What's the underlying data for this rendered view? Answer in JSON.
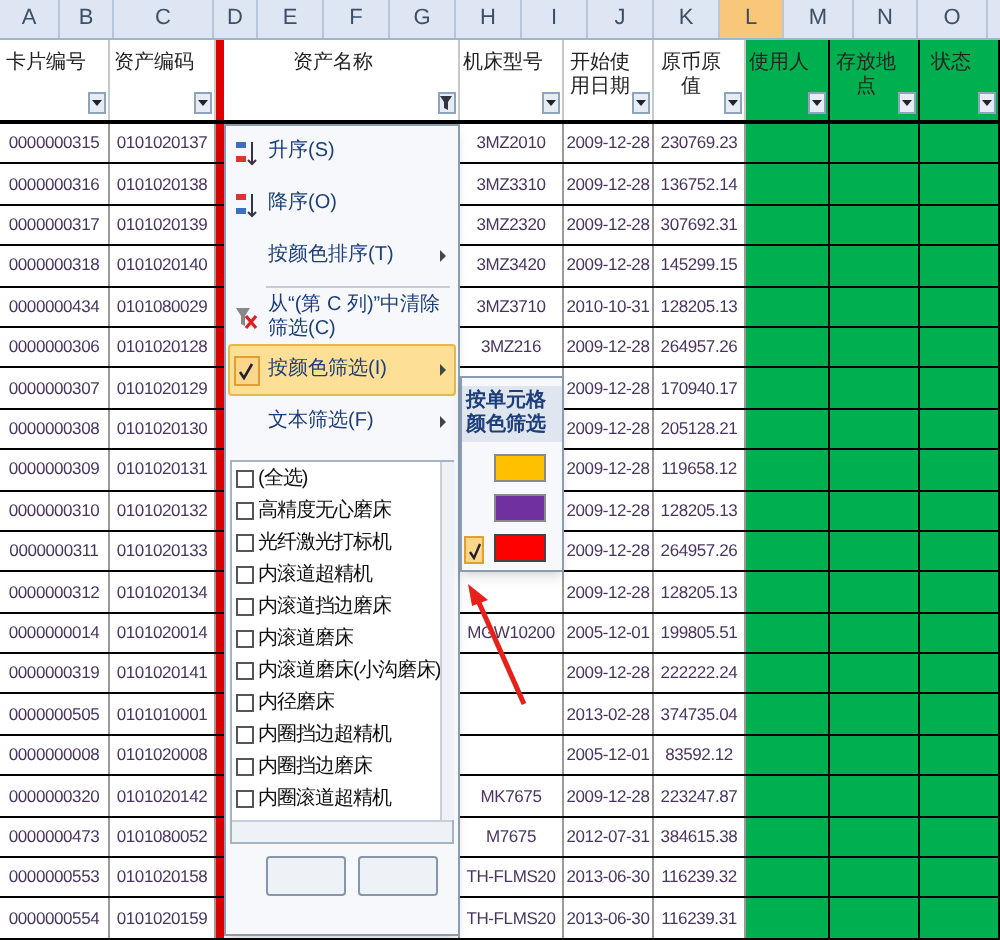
{
  "column_letters": [
    {
      "label": "A",
      "selected": false
    },
    {
      "label": "B",
      "selected": false
    },
    {
      "label": "C",
      "selected": false
    },
    {
      "label": "D",
      "selected": false
    },
    {
      "label": "E",
      "selected": false
    },
    {
      "label": "F",
      "selected": false
    },
    {
      "label": "G",
      "selected": false
    },
    {
      "label": "H",
      "selected": false
    },
    {
      "label": "I",
      "selected": false
    },
    {
      "label": "J",
      "selected": false
    },
    {
      "label": "K",
      "selected": false
    },
    {
      "label": "L",
      "selected": true
    },
    {
      "label": "M",
      "selected": false
    },
    {
      "label": "N",
      "selected": false
    },
    {
      "label": "O",
      "selected": false
    }
  ],
  "columns": [
    {
      "header": "卡片编号",
      "filtered": false,
      "filled": false
    },
    {
      "header": "资产编码",
      "filtered": false,
      "filled": false
    },
    {
      "header": "资产名称",
      "filtered": true,
      "filled": false
    },
    {
      "header": "机床型号",
      "filtered": false,
      "filled": false
    },
    {
      "header": "开始使用日期",
      "filtered": false,
      "filled": false
    },
    {
      "header": "原币原值",
      "filtered": false,
      "filled": false
    },
    {
      "header": "使用人",
      "filtered": false,
      "filled": true
    },
    {
      "header": "存放地点",
      "filtered": false,
      "filled": true
    },
    {
      "header": "状态",
      "filtered": false,
      "filled": true
    }
  ],
  "rows": [
    {
      "card_no": "0000000315",
      "asset_code": "0101020137",
      "model": "3MZ2010",
      "start_date": "2009-12-28",
      "value": "230769.23"
    },
    {
      "card_no": "0000000316",
      "asset_code": "0101020138",
      "model": "3MZ3310",
      "start_date": "2009-12-28",
      "value": "136752.14"
    },
    {
      "card_no": "0000000317",
      "asset_code": "0101020139",
      "model": "3MZ2320",
      "start_date": "2009-12-28",
      "value": "307692.31"
    },
    {
      "card_no": "0000000318",
      "asset_code": "0101020140",
      "model": "3MZ3420",
      "start_date": "2009-12-28",
      "value": "145299.15"
    },
    {
      "card_no": "0000000434",
      "asset_code": "0101080029",
      "model": "3MZ3710",
      "start_date": "2010-10-31",
      "value": "128205.13"
    },
    {
      "card_no": "0000000306",
      "asset_code": "0101020128",
      "model": "3MZ216",
      "start_date": "2009-12-28",
      "value": "264957.26"
    },
    {
      "card_no": "0000000307",
      "asset_code": "0101020129",
      "start_date": "2009-12-28",
      "value": "170940.17"
    },
    {
      "card_no": "0000000308",
      "asset_code": "0101020130",
      "start_date": "2009-12-28",
      "value": "205128.21"
    },
    {
      "card_no": "0000000309",
      "asset_code": "0101020131",
      "start_date": "2009-12-28",
      "value": "119658.12"
    },
    {
      "card_no": "0000000310",
      "asset_code": "0101020132",
      "start_date": "2009-12-28",
      "value": "128205.13"
    },
    {
      "card_no": "0000000311",
      "asset_code": "0101020133",
      "start_date": "2009-12-28",
      "value": "264957.26"
    },
    {
      "card_no": "0000000312",
      "asset_code": "0101020134",
      "start_date": "2009-12-28",
      "value": "128205.13"
    },
    {
      "card_no": "0000000014",
      "asset_code": "0101020014",
      "model": "MGW10200",
      "start_date": "2005-12-01",
      "value": "199805.51"
    },
    {
      "card_no": "0000000319",
      "asset_code": "0101020141",
      "start_date": "2009-12-28",
      "value": "222222.24"
    },
    {
      "card_no": "0000000505",
      "asset_code": "0101010001",
      "start_date": "2013-02-28",
      "value": "374735.04"
    },
    {
      "card_no": "0000000008",
      "asset_code": "0101020008",
      "start_date": "2005-12-01",
      "value": "83592.12"
    },
    {
      "card_no": "0000000320",
      "asset_code": "0101020142",
      "model": "MK7675",
      "start_date": "2009-12-28",
      "value": "223247.87"
    },
    {
      "card_no": "0000000473",
      "asset_code": "0101080052",
      "model": "M7675",
      "start_date": "2012-07-31",
      "value": "384615.38"
    },
    {
      "card_no": "0000000553",
      "asset_code": "0101020158",
      "model": "TH-FLMS20",
      "start_date": "2013-06-30",
      "value": "116239.32"
    },
    {
      "card_no": "0000000554",
      "asset_code": "0101020159",
      "model": "TH-FLMS20",
      "start_date": "2013-06-30",
      "value": "116239.31"
    }
  ],
  "filter_menu": {
    "items": [
      {
        "kind": "sort_asc",
        "label": "升序(S)",
        "highlighted": false,
        "checked": false
      },
      {
        "kind": "sort_desc",
        "label": "降序(O)",
        "highlighted": false,
        "checked": false
      },
      {
        "kind": "submenu",
        "label": "按颜色排序(T)",
        "highlighted": false,
        "checked": false
      },
      {
        "kind": "separator"
      },
      {
        "kind": "clear",
        "label": "从“(第 C 列)”中清除筛选(C)",
        "highlighted": false,
        "checked": false
      },
      {
        "kind": "submenu",
        "label": "按颜色筛选(I)",
        "highlighted": true,
        "checked": true
      },
      {
        "kind": "submenu",
        "label": "文本筛选(F)",
        "highlighted": false,
        "checked": false
      }
    ],
    "values": [
      {
        "label": "(全选)",
        "checked": false
      },
      {
        "label": "高精度无心磨床",
        "checked": false
      },
      {
        "label": "光纤激光打标机",
        "checked": false
      },
      {
        "label": "内滚道超精机",
        "checked": false
      },
      {
        "label": "内滚道挡边磨床",
        "checked": false
      },
      {
        "label": "内滚道磨床",
        "checked": false
      },
      {
        "label": "内滚道磨床(小沟磨床)",
        "checked": false
      },
      {
        "label": "内径磨床",
        "checked": false
      },
      {
        "label": "内圈挡边超精机",
        "checked": false
      },
      {
        "label": "内圈挡边磨床",
        "checked": false
      },
      {
        "label": "内圈滚道超精机",
        "checked": false
      }
    ]
  },
  "color_submenu": {
    "title": "按单元格颜色筛选",
    "swatches": [
      {
        "color": "#ffc000",
        "selected": false
      },
      {
        "color": "#7030a0",
        "selected": false
      },
      {
        "color": "#ff0000",
        "selected": true
      }
    ]
  }
}
